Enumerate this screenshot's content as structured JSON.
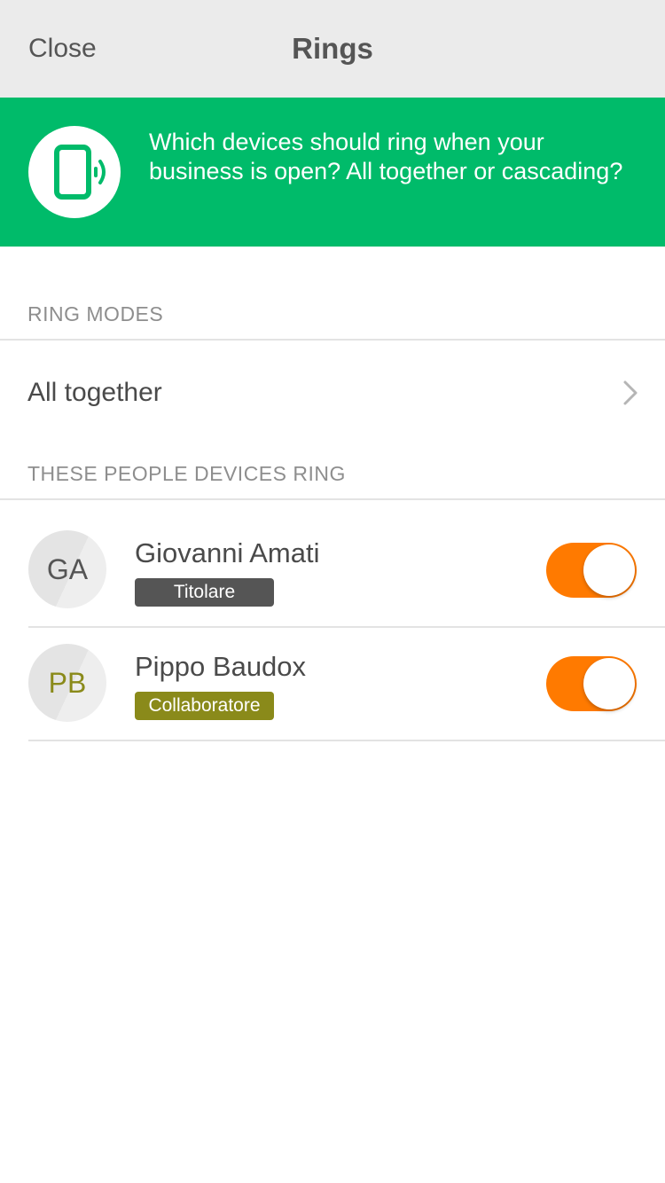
{
  "nav": {
    "close_label": "Close",
    "title": "Rings"
  },
  "banner": {
    "icon": "phone-ringing-icon",
    "text": "Which devices should ring when your business is open? All together or cascading?",
    "background_color": "#00bb6a"
  },
  "ring_modes": {
    "header": "RING MODES",
    "selected_mode": "All together"
  },
  "people": {
    "header": "THESE PEOPLE DEVICES RING",
    "items": [
      {
        "initials": "GA",
        "name": "Giovanni Amati",
        "role": "Titolare",
        "role_color": "#555555",
        "initials_color": "#555555",
        "ringing_enabled": true
      },
      {
        "initials": "PB",
        "name": "Pippo Baudox",
        "role": "Collaboratore",
        "role_color": "#8a8a1a",
        "initials_color": "#8a8a1a",
        "ringing_enabled": true
      }
    ]
  },
  "colors": {
    "toggle_on": "#ff7a00",
    "nav_background": "#ebebeb"
  }
}
